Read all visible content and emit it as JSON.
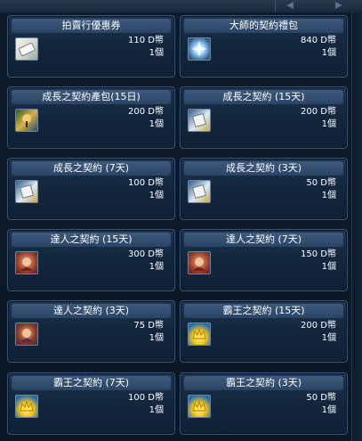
{
  "pager": {
    "prev_label": "◀",
    "next_label": "▶"
  },
  "items": [
    {
      "name": "拍賣行優惠券",
      "price": "110 D幣",
      "qty": "1個",
      "icon": "coupon-icon"
    },
    {
      "name": "大師的契約禮包",
      "price": "840 D幣",
      "qty": "1個",
      "icon": "gift-box-icon"
    },
    {
      "name": "成長之契約產包(15日)",
      "price": "200 D幣",
      "qty": "1個",
      "icon": "growth-pack-icon"
    },
    {
      "name": "成長之契約 (15天)",
      "price": "200 D幣",
      "qty": "1個",
      "icon": "growth-contract-icon"
    },
    {
      "name": "成長之契約 (7天)",
      "price": "100 D幣",
      "qty": "1個",
      "icon": "growth-contract-icon"
    },
    {
      "name": "成長之契約 (3天)",
      "price": "50 D幣",
      "qty": "1個",
      "icon": "growth-contract-icon"
    },
    {
      "name": "達人之契約 (15天)",
      "price": "300 D幣",
      "qty": "1個",
      "icon": "master-contract-icon"
    },
    {
      "name": "達人之契約 (7天)",
      "price": "150 D幣",
      "qty": "1個",
      "icon": "master-contract-icon"
    },
    {
      "name": "達人之契約 (3天)",
      "price": "75 D幣",
      "qty": "1個",
      "icon": "master-contract-icon"
    },
    {
      "name": "霸王之契約 (15天)",
      "price": "200 D幣",
      "qty": "1個",
      "icon": "king-contract-icon"
    },
    {
      "name": "霸王之契約 (7天)",
      "price": "100 D幣",
      "qty": "1個",
      "icon": "king-contract-icon"
    },
    {
      "name": "霸王之契約 (3天)",
      "price": "50 D幣",
      "qty": "1個",
      "icon": "king-contract-icon"
    }
  ]
}
